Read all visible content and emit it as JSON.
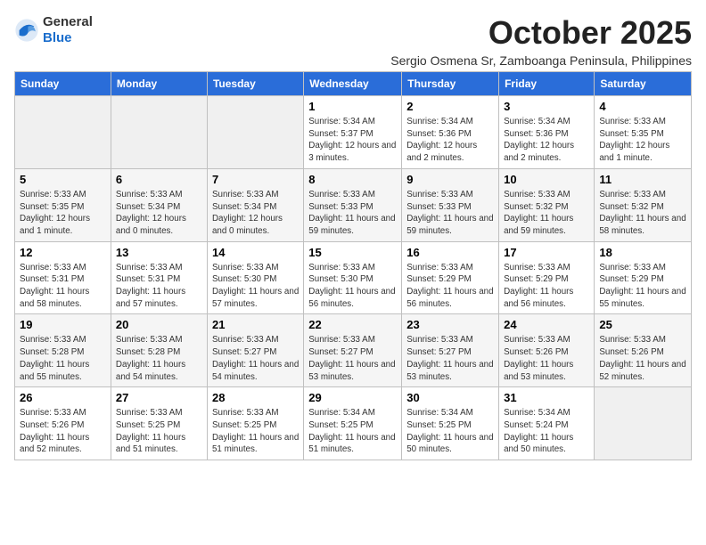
{
  "header": {
    "logo_general": "General",
    "logo_blue": "Blue",
    "month_year": "October 2025",
    "subtitle": "Sergio Osmena Sr, Zamboanga Peninsula, Philippines"
  },
  "days_of_week": [
    "Sunday",
    "Monday",
    "Tuesday",
    "Wednesday",
    "Thursday",
    "Friday",
    "Saturday"
  ],
  "weeks": [
    [
      {
        "day": "",
        "empty": true
      },
      {
        "day": "",
        "empty": true
      },
      {
        "day": "",
        "empty": true
      },
      {
        "day": "1",
        "sunrise": "Sunrise: 5:34 AM",
        "sunset": "Sunset: 5:37 PM",
        "daylight": "Daylight: 12 hours and 3 minutes."
      },
      {
        "day": "2",
        "sunrise": "Sunrise: 5:34 AM",
        "sunset": "Sunset: 5:36 PM",
        "daylight": "Daylight: 12 hours and 2 minutes."
      },
      {
        "day": "3",
        "sunrise": "Sunrise: 5:34 AM",
        "sunset": "Sunset: 5:36 PM",
        "daylight": "Daylight: 12 hours and 2 minutes."
      },
      {
        "day": "4",
        "sunrise": "Sunrise: 5:33 AM",
        "sunset": "Sunset: 5:35 PM",
        "daylight": "Daylight: 12 hours and 1 minute."
      }
    ],
    [
      {
        "day": "5",
        "sunrise": "Sunrise: 5:33 AM",
        "sunset": "Sunset: 5:35 PM",
        "daylight": "Daylight: 12 hours and 1 minute."
      },
      {
        "day": "6",
        "sunrise": "Sunrise: 5:33 AM",
        "sunset": "Sunset: 5:34 PM",
        "daylight": "Daylight: 12 hours and 0 minutes."
      },
      {
        "day": "7",
        "sunrise": "Sunrise: 5:33 AM",
        "sunset": "Sunset: 5:34 PM",
        "daylight": "Daylight: 12 hours and 0 minutes."
      },
      {
        "day": "8",
        "sunrise": "Sunrise: 5:33 AM",
        "sunset": "Sunset: 5:33 PM",
        "daylight": "Daylight: 11 hours and 59 minutes."
      },
      {
        "day": "9",
        "sunrise": "Sunrise: 5:33 AM",
        "sunset": "Sunset: 5:33 PM",
        "daylight": "Daylight: 11 hours and 59 minutes."
      },
      {
        "day": "10",
        "sunrise": "Sunrise: 5:33 AM",
        "sunset": "Sunset: 5:32 PM",
        "daylight": "Daylight: 11 hours and 59 minutes."
      },
      {
        "day": "11",
        "sunrise": "Sunrise: 5:33 AM",
        "sunset": "Sunset: 5:32 PM",
        "daylight": "Daylight: 11 hours and 58 minutes."
      }
    ],
    [
      {
        "day": "12",
        "sunrise": "Sunrise: 5:33 AM",
        "sunset": "Sunset: 5:31 PM",
        "daylight": "Daylight: 11 hours and 58 minutes."
      },
      {
        "day": "13",
        "sunrise": "Sunrise: 5:33 AM",
        "sunset": "Sunset: 5:31 PM",
        "daylight": "Daylight: 11 hours and 57 minutes."
      },
      {
        "day": "14",
        "sunrise": "Sunrise: 5:33 AM",
        "sunset": "Sunset: 5:30 PM",
        "daylight": "Daylight: 11 hours and 57 minutes."
      },
      {
        "day": "15",
        "sunrise": "Sunrise: 5:33 AM",
        "sunset": "Sunset: 5:30 PM",
        "daylight": "Daylight: 11 hours and 56 minutes."
      },
      {
        "day": "16",
        "sunrise": "Sunrise: 5:33 AM",
        "sunset": "Sunset: 5:29 PM",
        "daylight": "Daylight: 11 hours and 56 minutes."
      },
      {
        "day": "17",
        "sunrise": "Sunrise: 5:33 AM",
        "sunset": "Sunset: 5:29 PM",
        "daylight": "Daylight: 11 hours and 56 minutes."
      },
      {
        "day": "18",
        "sunrise": "Sunrise: 5:33 AM",
        "sunset": "Sunset: 5:29 PM",
        "daylight": "Daylight: 11 hours and 55 minutes."
      }
    ],
    [
      {
        "day": "19",
        "sunrise": "Sunrise: 5:33 AM",
        "sunset": "Sunset: 5:28 PM",
        "daylight": "Daylight: 11 hours and 55 minutes."
      },
      {
        "day": "20",
        "sunrise": "Sunrise: 5:33 AM",
        "sunset": "Sunset: 5:28 PM",
        "daylight": "Daylight: 11 hours and 54 minutes."
      },
      {
        "day": "21",
        "sunrise": "Sunrise: 5:33 AM",
        "sunset": "Sunset: 5:27 PM",
        "daylight": "Daylight: 11 hours and 54 minutes."
      },
      {
        "day": "22",
        "sunrise": "Sunrise: 5:33 AM",
        "sunset": "Sunset: 5:27 PM",
        "daylight": "Daylight: 11 hours and 53 minutes."
      },
      {
        "day": "23",
        "sunrise": "Sunrise: 5:33 AM",
        "sunset": "Sunset: 5:27 PM",
        "daylight": "Daylight: 11 hours and 53 minutes."
      },
      {
        "day": "24",
        "sunrise": "Sunrise: 5:33 AM",
        "sunset": "Sunset: 5:26 PM",
        "daylight": "Daylight: 11 hours and 53 minutes."
      },
      {
        "day": "25",
        "sunrise": "Sunrise: 5:33 AM",
        "sunset": "Sunset: 5:26 PM",
        "daylight": "Daylight: 11 hours and 52 minutes."
      }
    ],
    [
      {
        "day": "26",
        "sunrise": "Sunrise: 5:33 AM",
        "sunset": "Sunset: 5:26 PM",
        "daylight": "Daylight: 11 hours and 52 minutes."
      },
      {
        "day": "27",
        "sunrise": "Sunrise: 5:33 AM",
        "sunset": "Sunset: 5:25 PM",
        "daylight": "Daylight: 11 hours and 51 minutes."
      },
      {
        "day": "28",
        "sunrise": "Sunrise: 5:33 AM",
        "sunset": "Sunset: 5:25 PM",
        "daylight": "Daylight: 11 hours and 51 minutes."
      },
      {
        "day": "29",
        "sunrise": "Sunrise: 5:34 AM",
        "sunset": "Sunset: 5:25 PM",
        "daylight": "Daylight: 11 hours and 51 minutes."
      },
      {
        "day": "30",
        "sunrise": "Sunrise: 5:34 AM",
        "sunset": "Sunset: 5:25 PM",
        "daylight": "Daylight: 11 hours and 50 minutes."
      },
      {
        "day": "31",
        "sunrise": "Sunrise: 5:34 AM",
        "sunset": "Sunset: 5:24 PM",
        "daylight": "Daylight: 11 hours and 50 minutes."
      },
      {
        "day": "",
        "empty": true
      }
    ]
  ]
}
